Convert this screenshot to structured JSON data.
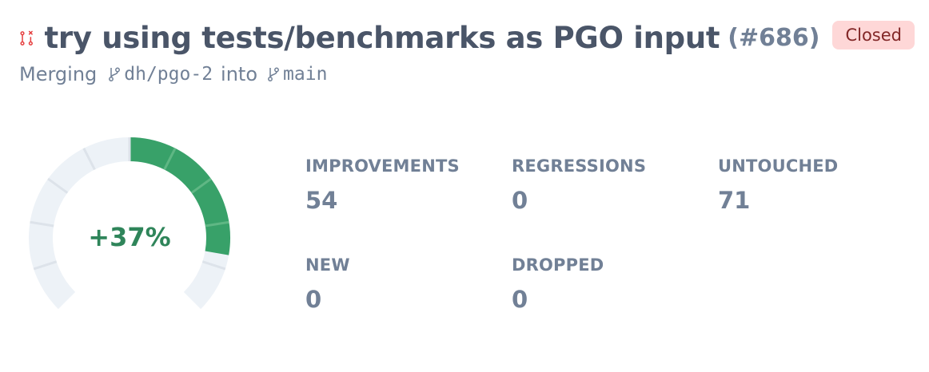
{
  "pr": {
    "title": "try using tests/benchmarks as PGO input",
    "number": "(#686)",
    "status": "Closed",
    "merge_prefix": "Merging",
    "source_branch": "dh/pgo-2",
    "merge_into": "into",
    "target_branch": "main"
  },
  "gauge": {
    "label": "+37%",
    "fraction_filled": 0.37,
    "accent_color": "#38a169"
  },
  "stats": [
    {
      "label": "IMPROVEMENTS",
      "value": "54"
    },
    {
      "label": "REGRESSIONS",
      "value": "0"
    },
    {
      "label": "UNTOUCHED",
      "value": "71"
    },
    {
      "label": "NEW",
      "value": "0"
    },
    {
      "label": "DROPPED",
      "value": "0"
    }
  ],
  "colors": {
    "closed_icon": "#e53e3e",
    "badge_bg": "#fed7d7",
    "badge_text": "#822727",
    "gauge_track": "#edf2f7",
    "gauge_fill": "#38a169",
    "percent_text": "#2f855a"
  },
  "icons": {
    "pr_state": "git-pull-request-closed-icon",
    "branch": "git-branch-icon"
  }
}
